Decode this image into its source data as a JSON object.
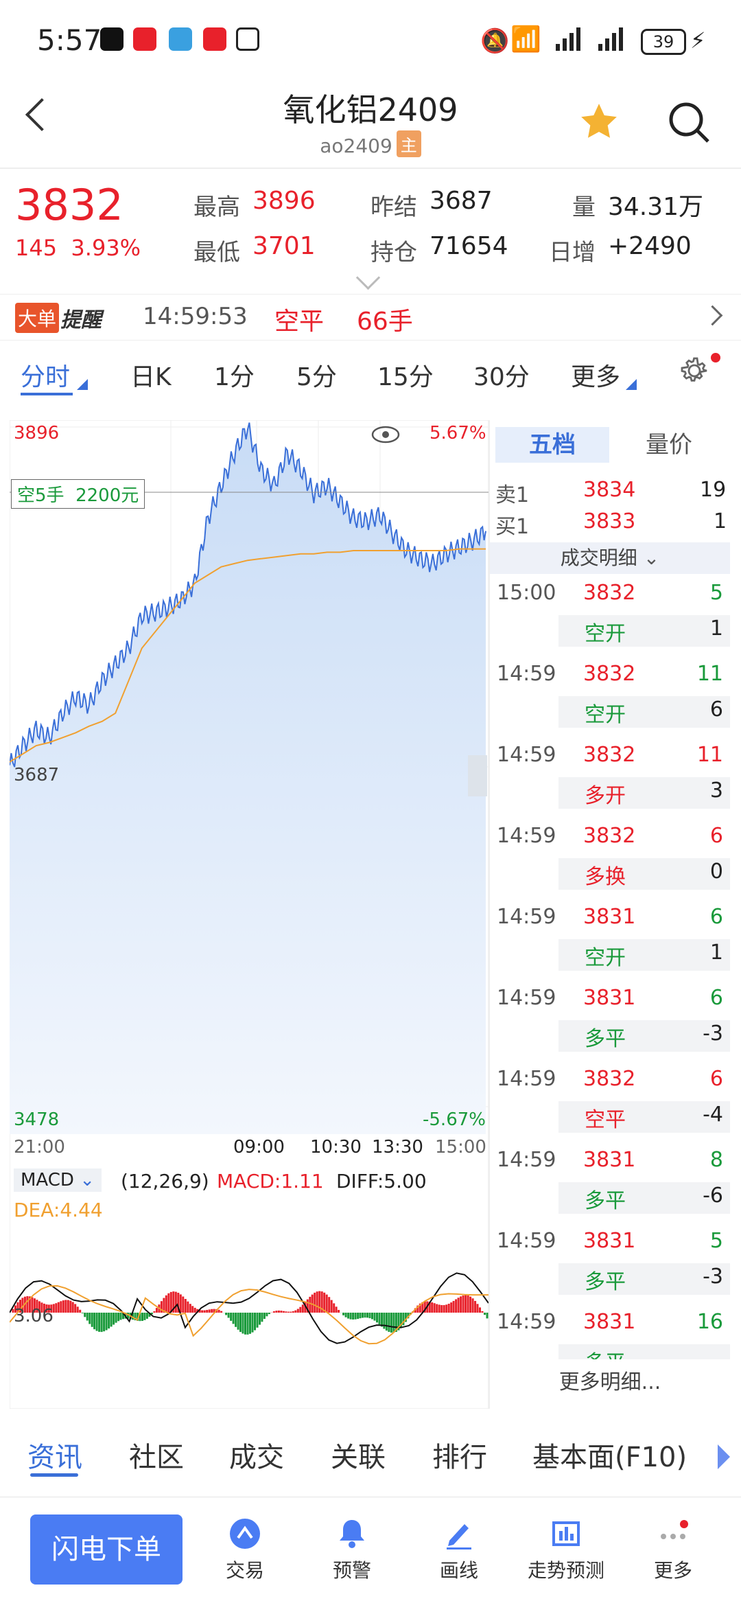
{
  "status_bar": {
    "time": "5:57",
    "battery": "39"
  },
  "header": {
    "title": "氧化铝2409",
    "code": "ao2409",
    "main_badge": "主"
  },
  "quote": {
    "last": "3832",
    "change": "145",
    "change_pct": "3.93%",
    "high_label": "最高",
    "high": "3896",
    "low_label": "最低",
    "low": "3701",
    "prev_settle_label": "昨结",
    "prev_settle": "3687",
    "open_interest_label": "持仓",
    "open_interest": "71654",
    "volume_label": "量",
    "volume": "34.31万",
    "daily_change_label": "日增",
    "daily_change": "+2490"
  },
  "alert": {
    "badge_a": "大单",
    "badge_b": "提醒",
    "time": "14:59:53",
    "action": "空平",
    "qty": "66手"
  },
  "period_tabs": [
    "分时",
    "日K",
    "1分",
    "5分",
    "15分",
    "30分",
    "更多"
  ],
  "chart": {
    "y_top": "3896",
    "y_mid": "3687",
    "y_bottom": "3478",
    "pct_top": "5.67%",
    "pct_bottom": "-5.67%",
    "marker": "空5手  2200元",
    "x_labels": [
      "21:00",
      "09:00",
      "10:30",
      "13:30",
      "15:00"
    ],
    "macd_selector": "MACD",
    "macd_params": "(12,26,9)",
    "macd_value": "MACD:1.11",
    "diff_value": "DIFF:5.00",
    "dea_value": "DEA:4.44",
    "macd_axis": "3.06"
  },
  "chart_data": {
    "type": "line",
    "series": [],
    "ylim": [
      3478,
      3896
    ],
    "price_series": [
      3688,
      3700,
      3710,
      3705,
      3720,
      3730,
      3725,
      3740,
      3750,
      3760,
      3780,
      3782,
      3785,
      3790,
      3800,
      3840,
      3860,
      3880,
      3896,
      3870,
      3860,
      3880,
      3870,
      3855,
      3860,
      3850,
      3840,
      3838,
      3842,
      3830,
      3820,
      3815,
      3812,
      3818,
      3822,
      3826,
      3832
    ],
    "avg_series": [
      3690,
      3695,
      3700,
      3702,
      3705,
      3708,
      3712,
      3715,
      3720,
      3740,
      3760,
      3770,
      3780,
      3790,
      3800,
      3805,
      3810,
      3812,
      3814,
      3815,
      3816,
      3817,
      3818,
      3818,
      3819,
      3819,
      3820,
      3820,
      3820,
      3820,
      3820,
      3820,
      3820,
      3820,
      3821,
      3821,
      3821
    ]
  },
  "right_panel": {
    "tab_active": "五档",
    "tab_other": "量价",
    "sell1_label": "卖1",
    "sell1_price": "3834",
    "sell1_vol": "19",
    "buy1_label": "买1",
    "buy1_price": "3833",
    "buy1_vol": "1",
    "detail_header": "成交明细",
    "ticks": [
      {
        "time": "15:00",
        "price": "3832",
        "vol": "5",
        "type": "空开",
        "oi": "1"
      },
      {
        "time": "14:59",
        "price": "3832",
        "vol": "11",
        "type": "空开",
        "oi": "6"
      },
      {
        "time": "14:59",
        "price": "3832",
        "vol": "11",
        "type": "多开",
        "oi": "3"
      },
      {
        "time": "14:59",
        "price": "3832",
        "vol": "6",
        "type": "多换",
        "oi": "0"
      },
      {
        "time": "14:59",
        "price": "3831",
        "vol": "6",
        "type": "空开",
        "oi": "1"
      },
      {
        "time": "14:59",
        "price": "3831",
        "vol": "6",
        "type": "多平",
        "oi": "-3"
      },
      {
        "time": "14:59",
        "price": "3832",
        "vol": "6",
        "type": "空平",
        "oi": "-4"
      },
      {
        "time": "14:59",
        "price": "3831",
        "vol": "8",
        "type": "多平",
        "oi": "-6"
      },
      {
        "time": "14:59",
        "price": "3831",
        "vol": "5",
        "type": "多平",
        "oi": "-3"
      },
      {
        "time": "14:59",
        "price": "3831",
        "vol": "16",
        "type": "多平",
        "oi": ""
      }
    ],
    "more": "更多明细..."
  },
  "bottom_tabs": [
    "资讯",
    "社区",
    "成交",
    "关联",
    "排行",
    "基本面(F10)"
  ],
  "bottom_bar": {
    "flash": "闪电下单",
    "items": [
      "交易",
      "预警",
      "画线",
      "走势预测",
      "更多"
    ]
  },
  "colors": {
    "up": "#e8212b",
    "down": "#1a9a3b",
    "accent": "#4a7cf3",
    "avg_line": "#f0a030",
    "price_line": "#3a6fd8"
  }
}
